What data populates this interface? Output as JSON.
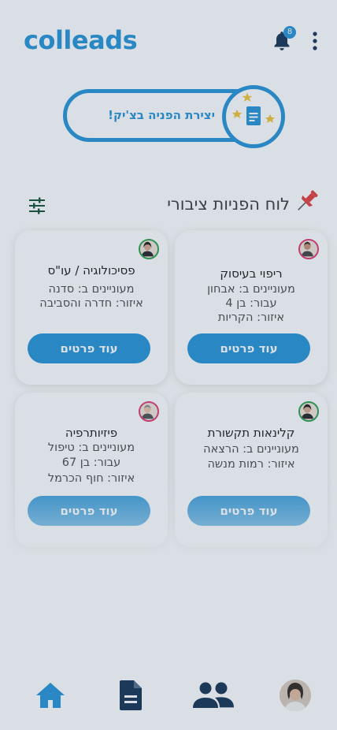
{
  "header": {
    "logo": {
      "part1": "c",
      "part2": "lleads",
      "prefix": "co"
    },
    "notification_count": "8",
    "icons": {
      "bell": "bell-icon",
      "menu": "kebab-menu-icon"
    }
  },
  "create_request": {
    "label": "יצירת הפניה בצ'יק!",
    "icon": "document-stars-icon"
  },
  "board": {
    "title": "לוח הפניות ציבורי",
    "pin_icon": "pushpin-icon",
    "filter_icon": "filter-sliders-icon"
  },
  "cards": [
    {
      "title": "ריפוי בעיסוק",
      "lines": [
        "מעוניינים ב: אבחון",
        "עבור: בן 4",
        "איזור: הקריות"
      ],
      "button": "עוד פרטים",
      "avatar_color": "#e0336d"
    },
    {
      "title": "פסיכולוגיה / עו\"ס",
      "lines": [
        "מעוניינים ב: סדנה",
        "איזור: חדרה והסביבה"
      ],
      "button": "עוד פרטים",
      "avatar_color": "#2a9d4a"
    },
    {
      "title": "קלינאות תקשורת",
      "lines": [
        "מעוניינים ב: הרצאה",
        "איזור: רמות מנשה"
      ],
      "button": "עוד פרטים",
      "avatar_color": "#2a9d4a"
    },
    {
      "title": "פיזיותרפיה",
      "lines": [
        "מעוניינים ב: טיפול",
        "עבור: בן 67",
        "איזור: חוף הכרמל"
      ],
      "button": "עוד פרטים",
      "avatar_color": "#e0336d"
    }
  ],
  "bottom_nav": {
    "items": [
      "home-icon",
      "document-icon",
      "group-icon",
      "profile-avatar"
    ],
    "active_color": "#1e8fd6",
    "inactive_color": "#0d2b4e"
  }
}
